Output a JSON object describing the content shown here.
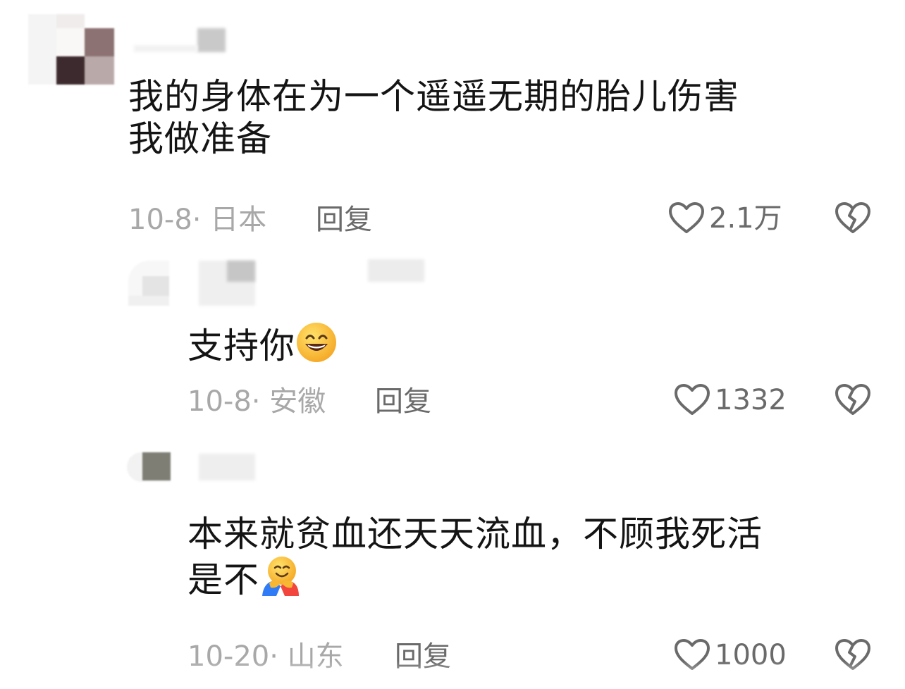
{
  "comments": [
    {
      "text": "我的身体在为一个遥遥无期的胎儿伤害我做准备",
      "line1": "我的身体在为一个遥遥无期的胎儿伤害",
      "line2": "我做准备",
      "date_location": "10-8· 日本",
      "reply_label": "回复",
      "likes": "2.1万",
      "emoji": ""
    },
    {
      "text": "支持你",
      "date_location": "10-8· 安徽",
      "reply_label": "回复",
      "likes": "1332",
      "emoji": "grinning-face-emoji"
    },
    {
      "text": "本来就贫血还天天流血，不顾我死活是不",
      "line1": "本来就贫血还天天流血，不顾我死活",
      "line2": "是不",
      "date_location": "10-20· 山东",
      "reply_label": "回复",
      "likes": "1000",
      "emoji": "hugging-face-emoji"
    }
  ],
  "icons": {
    "like": "heart-outline-icon",
    "dislike": "broken-heart-icon"
  },
  "colors": {
    "text": "#141414",
    "meta": "#a8a8a8",
    "action": "#6a6a6a"
  }
}
